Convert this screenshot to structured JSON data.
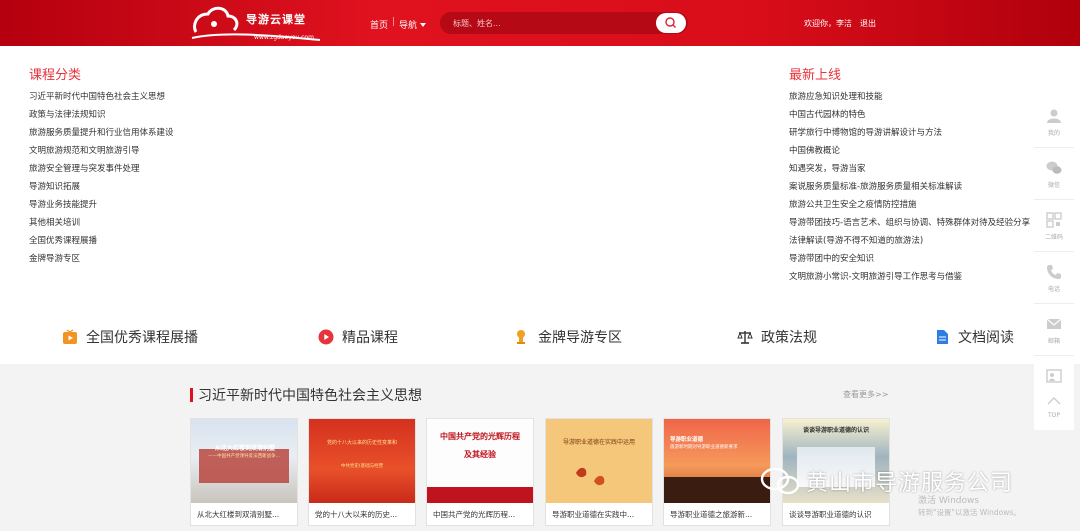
{
  "header": {
    "logo_title": "导游云课堂",
    "logo_url": "www.zgdaoyou.com",
    "nav_home": "首页",
    "nav_sep": "|",
    "nav_guide": "导航",
    "search_placeholder": "标题、姓名...",
    "user_welcome": "欢迎你，李洁",
    "user_logout": "退出"
  },
  "categories": {
    "title": "课程分类",
    "items": [
      "习近平新时代中国特色社会主义思想",
      "政策与法律法规知识",
      "旅游服务质量提升和行业信用体系建设",
      "文明旅游规范和文明旅游引导",
      "旅游安全管理与突发事件处理",
      "导游知识拓展",
      "导游业务技能提升",
      "其他相关培训",
      "全国优秀课程展播",
      "金牌导游专区"
    ]
  },
  "latest": {
    "title": "最新上线",
    "items": [
      "旅游应急知识处理和技能",
      "中国古代园林的特色",
      "研学旅行中博物馆的导游讲解设计与方法",
      "中国佛教概论",
      "知遇突发，导游当家",
      "案说服务质量标准-旅游服务质量相关标准解读",
      "旅游公共卫生安全之疫情防控措施",
      "导游带团技巧-语言艺术、组织与协调、特殊群体对待及经验分享",
      "法律解读(导游不得不知道的旅游法)",
      "导游带团中的安全知识",
      "文明旅游小常识-文明旅游引导工作思考与借鉴"
    ]
  },
  "features": [
    {
      "label": "全国优秀课程展播",
      "icon": "video-play-icon",
      "color": "#f29423"
    },
    {
      "label": "精品课程",
      "icon": "play-circle-icon",
      "color": "#e8333c"
    },
    {
      "label": "金牌导游专区",
      "icon": "medal-icon",
      "color": "#f0a020"
    },
    {
      "label": "政策法规",
      "icon": "scales-icon",
      "color": "#333333"
    },
    {
      "label": "文档阅读",
      "icon": "document-icon",
      "color": "#2f7de1"
    }
  ],
  "section": {
    "title": "习近平新时代中国特色社会主义思想",
    "more": "查看更多>>",
    "cards": [
      {
        "caption": "从北大红楼到双清别墅...",
        "thumb_title": "从北大红楼到双清别墅",
        "thumb_sub": "——中国共产党领导反法西斯战争..."
      },
      {
        "caption": "党的十八大以来的历史...",
        "thumb_title": "党的十八大以来的历史性变革和",
        "thumb_sub": "中共党史(基础与经营"
      },
      {
        "caption": "中国共产党的光辉历程...",
        "thumb_title": "中国共产党的光辉历程",
        "thumb_sub": "及其经验"
      },
      {
        "caption": "导游职业道德在实践中...",
        "thumb_title": "导游职业道德在实践中运用",
        "thumb_sub": ""
      },
      {
        "caption": "导游职业道德之旅游新...",
        "thumb_title": "导游职业道德",
        "thumb_sub": "旅游新时期对导游职业道德新要求"
      },
      {
        "caption": "谈谈导游职业道德的认识",
        "thumb_title": "谈谈导游职业道德的认识",
        "thumb_sub": ""
      }
    ]
  },
  "toolbar": [
    {
      "label": "我的",
      "icon": "user-icon"
    },
    {
      "label": "微信",
      "icon": "wechat-icon"
    },
    {
      "label": "二维码",
      "icon": "qrcode-icon"
    },
    {
      "label": "电话",
      "icon": "phone-icon"
    },
    {
      "label": "邮箱",
      "icon": "mail-icon"
    },
    {
      "label": "开课",
      "icon": "teach-icon"
    }
  ],
  "toolbar_top": "TOP",
  "watermark": {
    "text": "黄山市导游服务公司",
    "win_activate": "激活 Windows",
    "win_activate_sub": "转到\"设置\"以激活 Windows。"
  },
  "colors": {
    "brand_red": "#e0121f",
    "accent_red": "#e8333c"
  }
}
